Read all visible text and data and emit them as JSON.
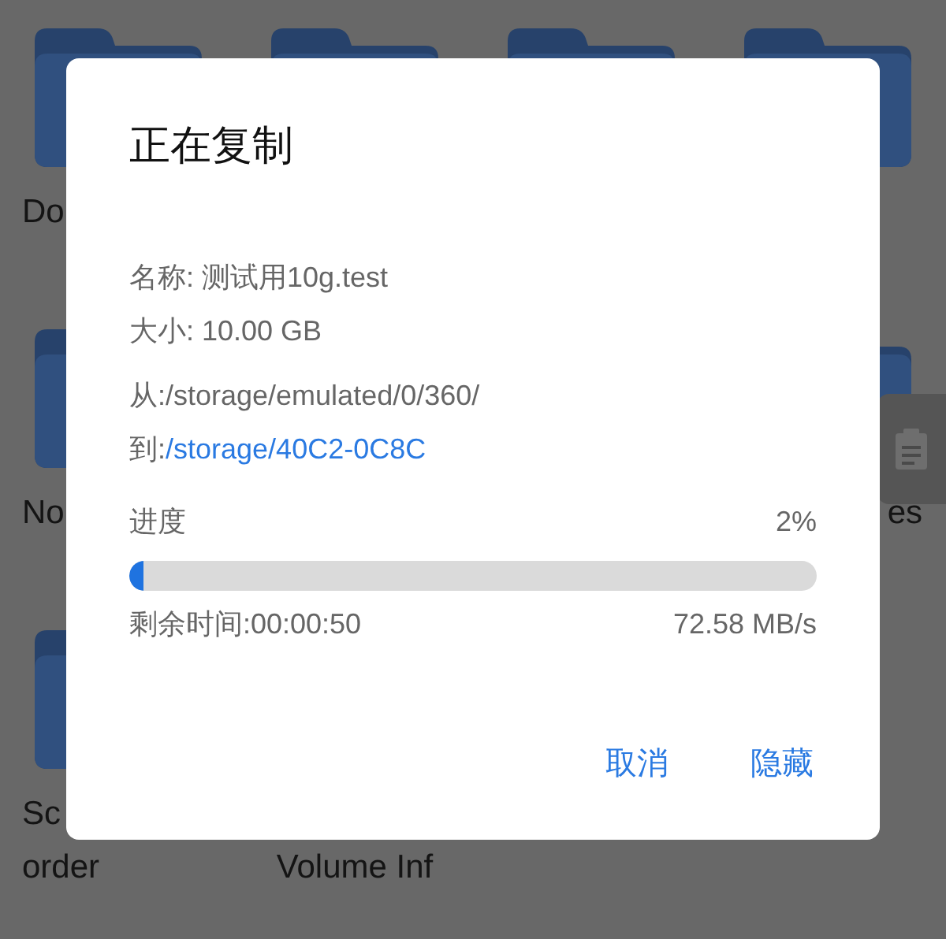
{
  "background": {
    "rows": [
      {
        "folders": [
          {
            "kind": "folder",
            "label": [
              "Do"
            ]
          },
          {
            "kind": "folder"
          },
          {
            "kind": "folder"
          },
          {
            "kind": "folder"
          }
        ]
      },
      {
        "folders": [
          {
            "kind": "folder",
            "label": [
              "No"
            ]
          },
          {
            "kind": "covered"
          },
          {
            "kind": "covered"
          },
          {
            "kind": "folder",
            "label": [
              "es"
            ]
          }
        ]
      },
      {
        "folders": [
          {
            "kind": "folder",
            "label": [
              "Sc",
              "order"
            ]
          },
          {
            "kind": "covered",
            "label": [
              "Volume Inf"
            ]
          }
        ]
      }
    ]
  },
  "dialog": {
    "title": "正在复制",
    "name": "名称: 测试用10g.test",
    "size": "大小: 10.00 GB",
    "from": "从:/storage/emulated/0/360/",
    "to_label": "到:",
    "to_path": "/storage/40C2-0C8C",
    "progress_label": "进度",
    "progress_percent": "2%",
    "level": 0.02,
    "remaining": "剩余时间:00:00:50",
    "speed": "72.58 MB/s",
    "buttons": [
      "取消",
      "隐藏"
    ]
  }
}
